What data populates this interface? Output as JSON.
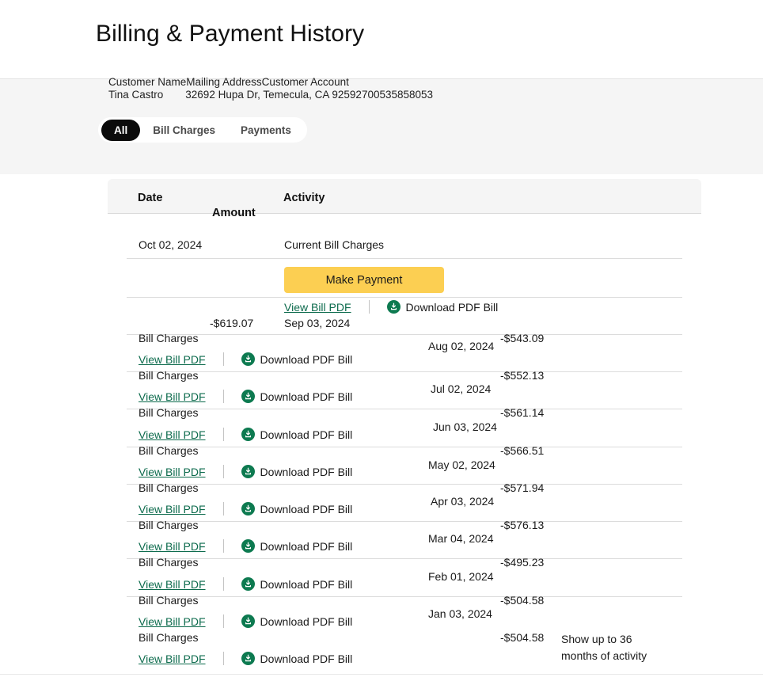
{
  "page": {
    "title": "Billing & Payment History"
  },
  "account": {
    "labels": {
      "customer_name": "Customer Name",
      "mailing_address": "Mailing Address",
      "customer_account": "Customer Account"
    },
    "values": {
      "customer_name": "Tina Castro",
      "mailing_address": "32692 Hupa Dr, Temecula, CA 92592",
      "customer_account": "700535858053"
    }
  },
  "tabs": [
    {
      "label": "All",
      "active": true
    },
    {
      "label": "Bill Charges",
      "active": false
    },
    {
      "label": "Payments",
      "active": false
    }
  ],
  "table": {
    "headers": {
      "date": "Date",
      "activity": "Activity",
      "amount": "Amount"
    },
    "current": {
      "date": "Oct 02, 2024",
      "activity": "Current Bill Charges",
      "pay_button": "Make Payment"
    },
    "actions": {
      "view_label": "View Bill PDF",
      "download_label": "Download PDF Bill",
      "download_icon": "download-circle-icon"
    },
    "activity_label": "Bill Charges",
    "rows": [
      {
        "date": "Sep 03, 2024",
        "activity": "Bill Charges",
        "amount": "-$619.07"
      },
      {
        "date": "Aug 02, 2024",
        "activity": "Bill Charges",
        "amount": "-$543.09"
      },
      {
        "date": "Jul 02, 2024",
        "activity": "Bill Charges",
        "amount": "-$552.13"
      },
      {
        "date": "Jun 03, 2024",
        "activity": "Bill Charges",
        "amount": "-$561.14"
      },
      {
        "date": "May 02, 2024",
        "activity": "Bill Charges",
        "amount": "-$566.51"
      },
      {
        "date": "Apr 03, 2024",
        "activity": "Bill Charges",
        "amount": "-$571.94"
      },
      {
        "date": "Mar 04, 2024",
        "activity": "Bill Charges",
        "amount": "-$576.13"
      },
      {
        "date": "Feb 01, 2024",
        "activity": "Bill Charges",
        "amount": "-$495.23"
      },
      {
        "date": "Jan 03, 2024",
        "activity": "Bill Charges",
        "amount": "-$504.58"
      }
    ]
  },
  "footnote": "Show up to 36 months of activity",
  "colors": {
    "accent_green": "#0d6b4d",
    "icon_green": "#0d7a50",
    "pay_button": "#fccf52",
    "band_grey": "#f5f5f5",
    "active_tab": "#0b0b0b"
  }
}
